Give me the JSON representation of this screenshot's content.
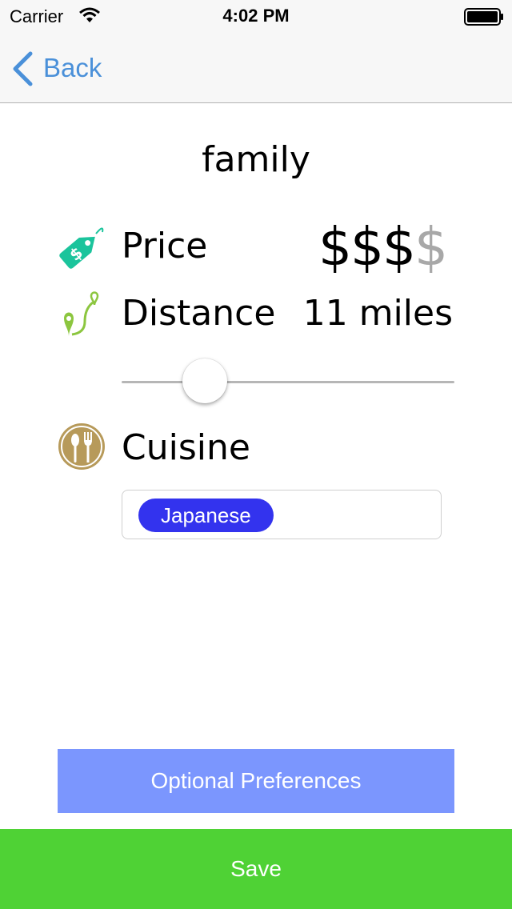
{
  "status_bar": {
    "carrier": "Carrier",
    "time": "4:02 PM",
    "icons": [
      "wifi-icon",
      "battery-icon"
    ]
  },
  "nav": {
    "back_label": "Back",
    "back_icon": "chevron-left-icon"
  },
  "title": "family",
  "price": {
    "label": "Price",
    "icon": "price-tag-icon",
    "active": "$$$",
    "inactive": "$",
    "level": 3,
    "max_level": 4
  },
  "distance": {
    "label": "Distance",
    "icon": "route-pin-icon",
    "value_text": "11 miles",
    "slider_fraction": 0.25
  },
  "cuisine": {
    "label": "Cuisine",
    "icon": "fork-spoon-icon",
    "tags": [
      "Japanese"
    ]
  },
  "buttons": {
    "optional": "Optional Preferences",
    "save": "Save"
  },
  "colors": {
    "back_blue": "#4a90d9",
    "price_icon": "#1bc49c",
    "distance_icon": "#8cc63f",
    "cuisine_icon": "#b79a5a",
    "tag_blue": "#3333ee",
    "optional_button": "#7b96fe",
    "save_button": "#4fd235",
    "inactive_price": "#a8a8a8"
  }
}
